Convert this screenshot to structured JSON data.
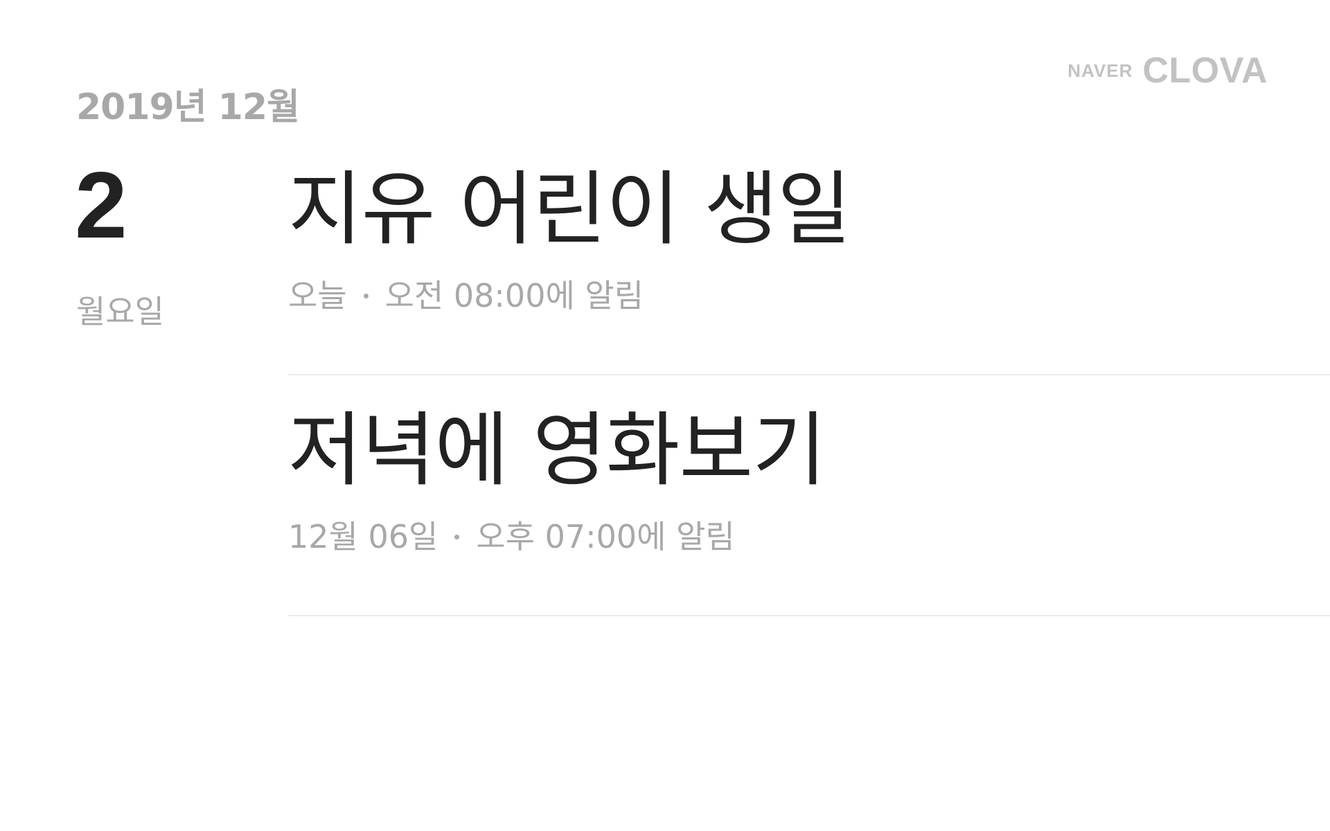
{
  "brand": {
    "naver": "NAVER",
    "clova": "CLOVA"
  },
  "date": {
    "month_label": "2019년 12월",
    "day": "2",
    "weekday": "월요일"
  },
  "events": [
    {
      "title": "지유 어린이 생일",
      "when": "오늘",
      "alarm": "오전 08:00에 알림"
    },
    {
      "title": "저녁에 영화보기",
      "when": "12월 06일",
      "alarm": "오후 07:00에 알림"
    }
  ]
}
